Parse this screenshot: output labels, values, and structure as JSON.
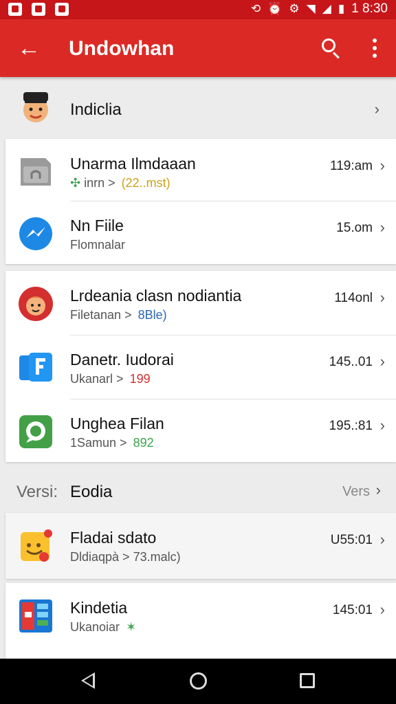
{
  "status_bar": {
    "time": "1 8:30",
    "left_icons": [
      "notification-icon",
      "gmail-icon",
      "message-icon"
    ],
    "right_icons": [
      "sync-icon",
      "alarm-icon",
      "settings-icon",
      "wifi-icon",
      "signal-icon",
      "battery-icon"
    ]
  },
  "app_bar": {
    "title": "Undowhan",
    "color": "#db2a25",
    "actions": [
      "back-arrow-icon",
      "search-icon",
      "more-vert-icon"
    ]
  },
  "header_item": {
    "title": "Indiclia",
    "icon": "avatar-icon"
  },
  "card1": [
    {
      "title": "Unarma Ilmdaaan",
      "sub": "inrn >",
      "accent": "(22..mst)",
      "accent_color": "#c8a21a",
      "time": "119:am",
      "icon": "file-icon",
      "prefix": "✣"
    },
    {
      "title": "Nn Fiile",
      "sub": "Flomnalar",
      "accent": "",
      "accent_color": "#555555",
      "time": "15.om",
      "icon": "messenger-icon",
      "prefix": ""
    }
  ],
  "card2": [
    {
      "title": "Lrdeania clasn nodiantia",
      "sub": "Filetanan >",
      "accent": "8Ble)",
      "accent_color": "#2a66b3",
      "time": "114onl",
      "icon": "avatar-icon",
      "prefix": ""
    },
    {
      "title": "Danetr. Iudorai",
      "sub": "Ukanarl >",
      "accent": "199",
      "accent_color": "#d32f2f",
      "time": "145..01",
      "icon": "files-app-icon",
      "prefix": ""
    },
    {
      "title": "Unghea Filan",
      "sub": "1Samun >",
      "accent": "892",
      "accent_color": "#3aa34a",
      "time": "195.:81",
      "icon": "chat-icon",
      "prefix": ""
    }
  ],
  "section": {
    "label": "Versi:",
    "title": "Eodia",
    "right": "Vers"
  },
  "card3": [
    {
      "title": "Fladai sdato",
      "sub": "Dldiaqpà > 73.malc)",
      "accent": "",
      "accent_color": "#555555",
      "time": "U55:01",
      "icon": "emoji-icon",
      "prefix": ""
    }
  ],
  "card4": [
    {
      "title": "Kindetia",
      "sub": "Ukanoiar",
      "accent": "✶",
      "accent_color": "#3aa34a",
      "time": "145:01",
      "icon": "grid-app-icon",
      "prefix": ""
    }
  ]
}
